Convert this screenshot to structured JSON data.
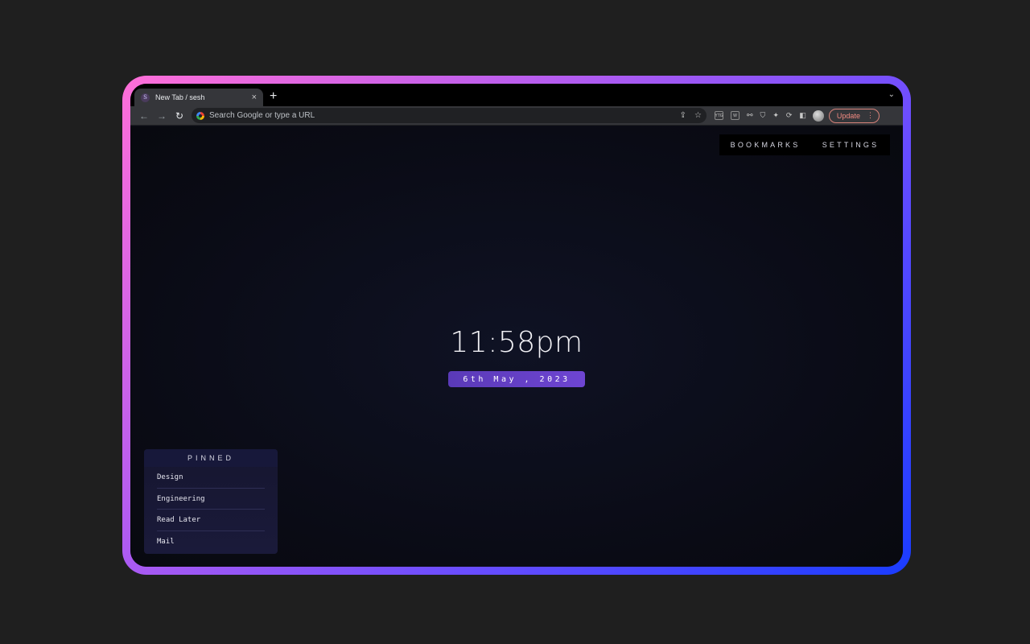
{
  "browser": {
    "tab_title": "New Tab / sesh",
    "tab_favicon_letter": "S",
    "tab_close": "×",
    "new_tab": "+",
    "tab_menu": "⌄",
    "nav": {
      "back": "←",
      "forward": "→",
      "reload": "↻"
    },
    "omnibox_placeholder": "Search Google or type a URL",
    "omnibox_icons": [
      "share-icon",
      "star-icon"
    ],
    "extensions": [
      "ytg-extension-icon",
      "reader-extension-icon",
      "glasses-extension-icon",
      "shield-extension-icon",
      "puzzle-icon",
      "sync-extension-icon",
      "sidepanel-icon"
    ],
    "ext_labels": {
      "ytg": "YTG",
      "reader": "W"
    },
    "update_label": "Update",
    "update_menu": "⋮"
  },
  "page": {
    "nav": {
      "bookmarks": "BOOKMARKS",
      "settings": "SETTINGS"
    },
    "time": "11:58pm",
    "date": "6th May , 2023",
    "pinned": {
      "title": "PINNED",
      "items": [
        "Design",
        "Engineering",
        "Read Later",
        "Mail"
      ]
    }
  },
  "colors": {
    "frame_gradient": [
      "#ff6fd8",
      "#b35cf0",
      "#6a4dff",
      "#1a3cff"
    ],
    "date_badge": "#5a3ab8",
    "update_accent": "#f28b82"
  }
}
